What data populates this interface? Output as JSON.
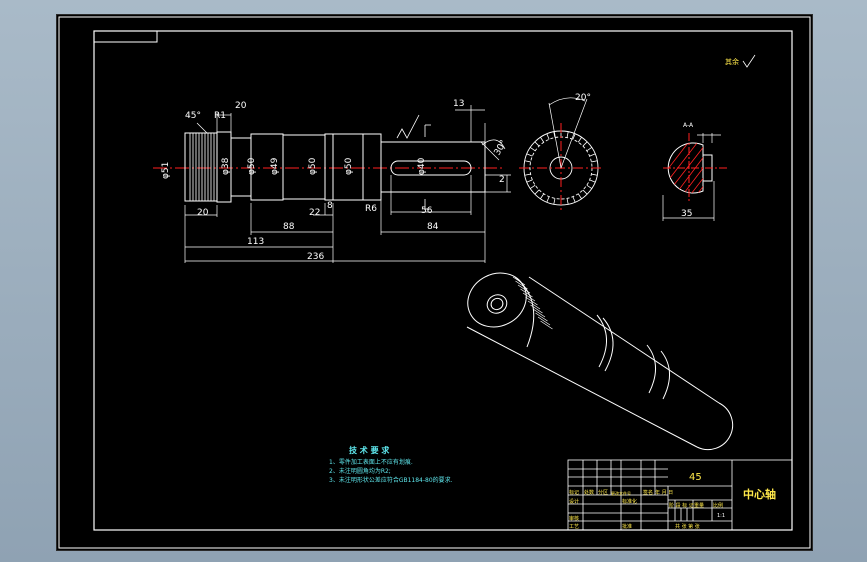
{
  "drawing": {
    "dims": {
      "d_45deg": "45°",
      "d_20_top": "20",
      "d_r1": "R1",
      "d_13": "13",
      "d_phi51": "φ51",
      "d_phi38": "φ38",
      "d_phi50a": "φ50",
      "d_phi49": "φ49",
      "d_phi50b": "φ50",
      "d_phi50c": "φ50",
      "d_phi40": "φ40",
      "d_20_bot": "20",
      "d_22": "22",
      "d_8": "8",
      "d_r6": "R6",
      "d_56": "56",
      "d_88": "88",
      "d_84": "84",
      "d_113": "113",
      "d_236": "236",
      "d_2": "2",
      "d_30deg": "30°",
      "d_20deg": "20°",
      "d_35": "35",
      "section_label": "A-A",
      "roughness_note": "其余"
    }
  },
  "tech_req": {
    "title": "技 术 要 求",
    "lines": [
      "1、零件加工表面上不应有划痕.",
      "2、未注明圆角均为R2;",
      "3、未注明形状公差应符合GB1184-80的要求."
    ]
  },
  "title_block": {
    "material": "45",
    "part_name": "中心轴",
    "row_labels": [
      "标记",
      "处数",
      "分区",
      "更改文件号",
      "签名",
      "年 月 日"
    ],
    "left_labels": [
      "设计",
      "审核",
      "工艺"
    ],
    "mid_labels": [
      "标准化",
      "批准"
    ],
    "stage_labels": [
      "阶 段 标 记",
      "重量",
      "比例"
    ],
    "scale": "1:1",
    "sheet_info": "共  张  第  张"
  },
  "colors": {
    "part": "#ffffff",
    "dimension": "#5fe8ee",
    "centerline": "#ff2020",
    "hatch": "#ff2020",
    "frame": "#ffffff"
  }
}
